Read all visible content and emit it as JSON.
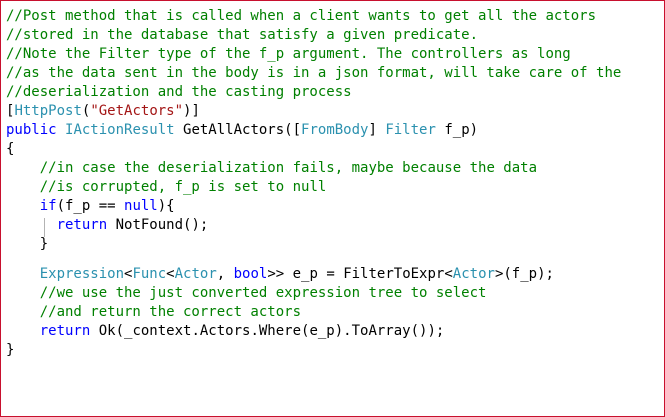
{
  "colors": {
    "comment": "#008000",
    "keyword": "#0000ff",
    "type": "#2b91af",
    "string": "#a31515",
    "plain": "#000000",
    "border": "#c8102e"
  },
  "code_lines": [
    [
      {
        "t": "//Post method that is called when a client wants to get all the actors",
        "k": "comment"
      }
    ],
    [
      {
        "t": "//stored in the database that satisfy a given predicate.",
        "k": "comment"
      }
    ],
    [
      {
        "t": "//Note the Filter type of the f_p argument. The controllers as long",
        "k": "comment"
      }
    ],
    [
      {
        "t": "//as the data sent in the body is in a json format, will take care of the",
        "k": "comment"
      }
    ],
    [
      {
        "t": "//deserialization and the casting process",
        "k": "comment"
      }
    ],
    [
      {
        "t": "[",
        "k": "plain"
      },
      {
        "t": "HttpPost",
        "k": "type"
      },
      {
        "t": "(",
        "k": "plain"
      },
      {
        "t": "\"GetActors\"",
        "k": "string"
      },
      {
        "t": ")]",
        "k": "plain"
      }
    ],
    [
      {
        "t": "public ",
        "k": "keyword"
      },
      {
        "t": "IActionResult",
        "k": "type"
      },
      {
        "t": " GetAllActors([",
        "k": "plain"
      },
      {
        "t": "FromBody",
        "k": "type"
      },
      {
        "t": "] ",
        "k": "plain"
      },
      {
        "t": "Filter",
        "k": "type"
      },
      {
        "t": " f_p)",
        "k": "plain"
      }
    ],
    [
      {
        "t": "{",
        "k": "plain"
      }
    ],
    [
      {
        "t": "    ",
        "k": "plain"
      },
      {
        "t": "//in case the deserialization fails, maybe because the data",
        "k": "comment"
      }
    ],
    [
      {
        "t": "    ",
        "k": "plain"
      },
      {
        "t": "//is corrupted, f_p is set to null",
        "k": "comment"
      }
    ],
    [
      {
        "t": "    ",
        "k": "plain"
      },
      {
        "t": "if",
        "k": "keyword"
      },
      {
        "t": "(f_p == ",
        "k": "plain"
      },
      {
        "t": "null",
        "k": "keyword"
      },
      {
        "t": "){",
        "k": "plain"
      }
    ],
    [
      {
        "t": "      ",
        "k": "plain"
      },
      {
        "t": "return",
        "k": "keyword"
      },
      {
        "t": " NotFound();",
        "k": "plain"
      }
    ],
    [
      {
        "t": "    }",
        "k": "plain"
      }
    ],
    [],
    [
      {
        "t": "    ",
        "k": "plain"
      },
      {
        "t": "Expression",
        "k": "type"
      },
      {
        "t": "<",
        "k": "plain"
      },
      {
        "t": "Func",
        "k": "type"
      },
      {
        "t": "<",
        "k": "plain"
      },
      {
        "t": "Actor",
        "k": "type"
      },
      {
        "t": ", ",
        "k": "plain"
      },
      {
        "t": "bool",
        "k": "keyword"
      },
      {
        "t": ">> e_p = FilterToExpr<",
        "k": "plain"
      },
      {
        "t": "Actor",
        "k": "type"
      },
      {
        "t": ">(f_p);",
        "k": "plain"
      }
    ],
    [
      {
        "t": "    ",
        "k": "plain"
      },
      {
        "t": "//we use the just converted expression tree to select",
        "k": "comment"
      }
    ],
    [
      {
        "t": "    ",
        "k": "plain"
      },
      {
        "t": "//and return the correct actors",
        "k": "comment"
      }
    ],
    [
      {
        "t": "    ",
        "k": "plain"
      },
      {
        "t": "return",
        "k": "keyword"
      },
      {
        "t": " Ok(_context.Actors.Where(e_p).ToArray());",
        "k": "plain"
      }
    ],
    [
      {
        "t": "}",
        "k": "plain"
      }
    ]
  ]
}
